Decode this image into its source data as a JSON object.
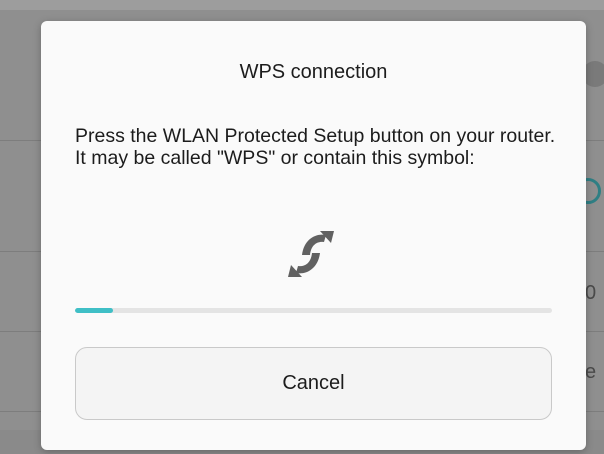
{
  "dialog": {
    "title": "WPS connection",
    "message": "Press the WLAN Protected Setup button on your router. It may be called \"WPS\" or contain this symbol:",
    "icon": "wps-icon",
    "progress": 0.08,
    "cancel_label": "Cancel"
  },
  "background": {
    "right_edge_chars": [
      "0",
      "e"
    ]
  },
  "colors": {
    "accent": "#3fbfc6",
    "icon": "#616161"
  }
}
